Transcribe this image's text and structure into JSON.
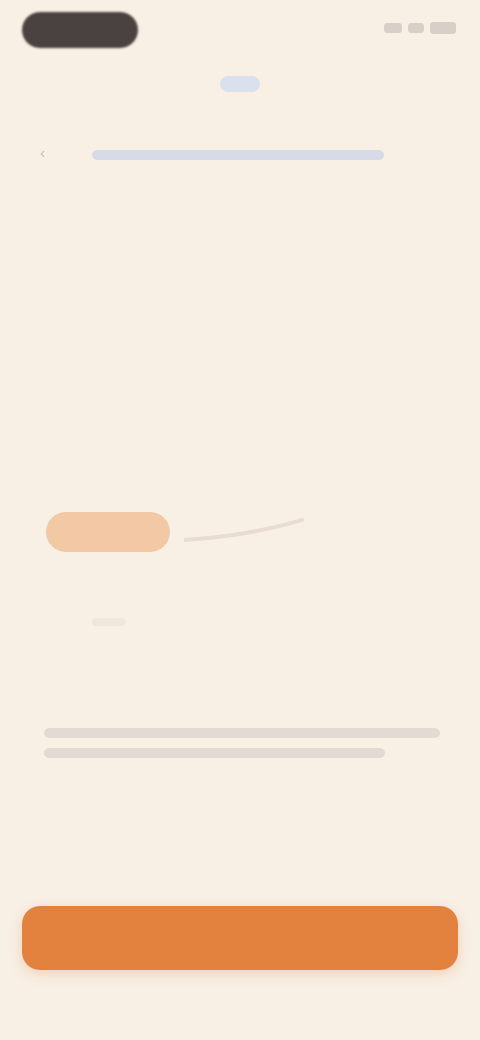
{
  "status_bar": {
    "icons": [
      "signal-icon",
      "wifi-icon",
      "battery-icon"
    ]
  },
  "header": {
    "brand": "",
    "progress_fraction": 1.0
  },
  "screen": {
    "title": "",
    "answer_chip": "",
    "info_text": ""
  },
  "cta": {
    "label": ""
  },
  "colors": {
    "background": "#f8efe5",
    "accent": "#e3813f",
    "brand": "#4a5f9a"
  }
}
